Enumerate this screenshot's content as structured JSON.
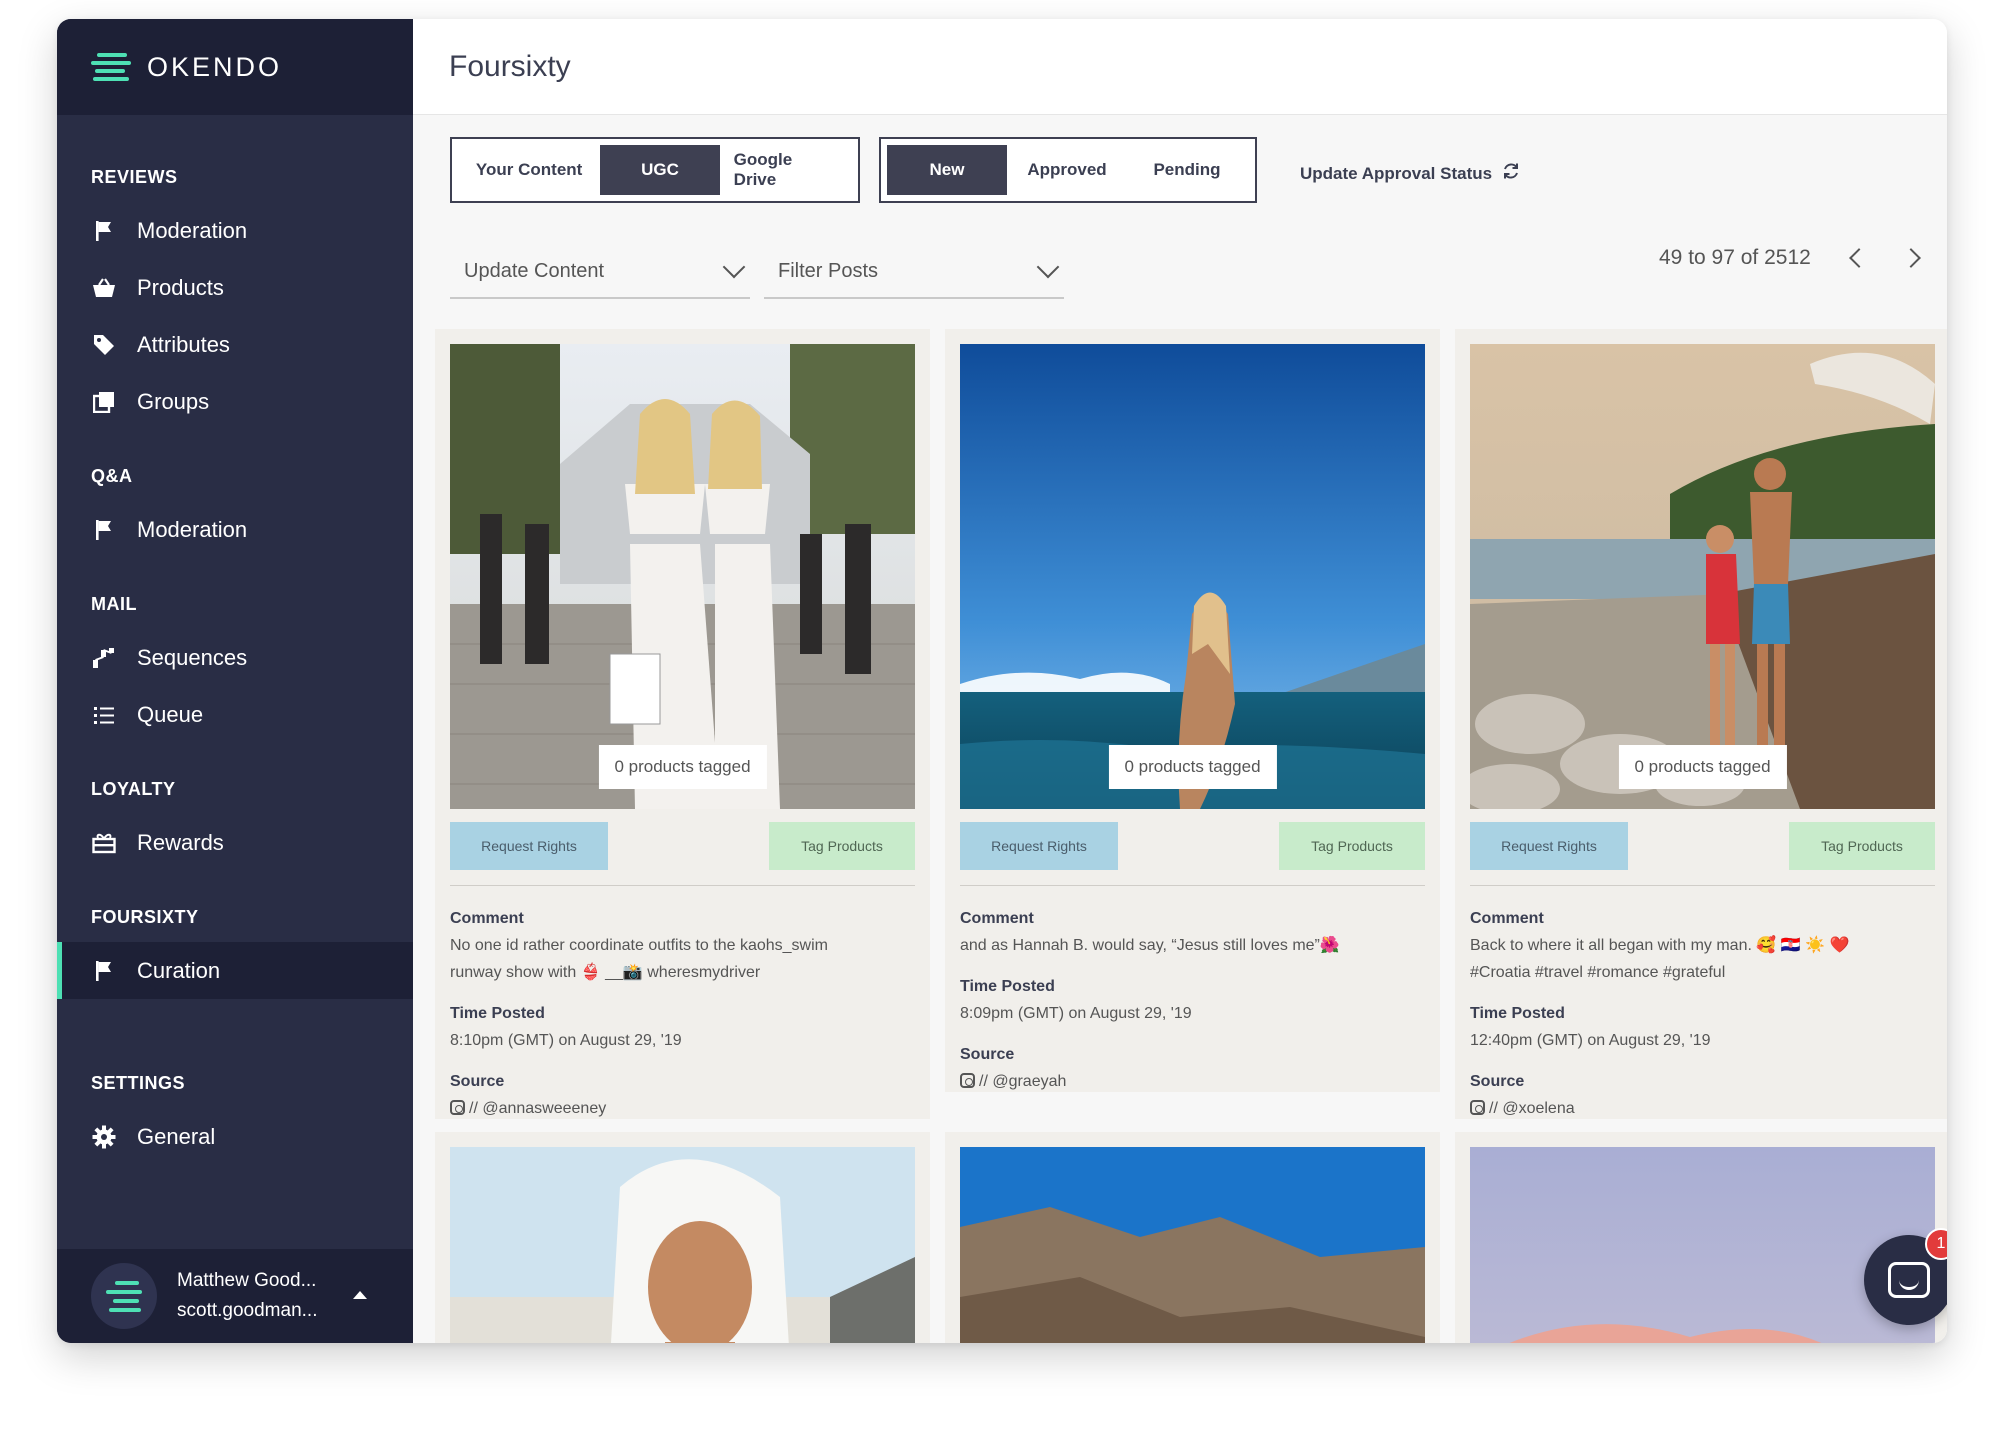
{
  "brand": {
    "name": "OKENDO"
  },
  "sidebar": {
    "sections": [
      {
        "title": "REVIEWS",
        "items": [
          {
            "label": "Moderation",
            "icon": "flag-icon"
          },
          {
            "label": "Products",
            "icon": "basket-icon"
          },
          {
            "label": "Attributes",
            "icon": "tag-icon"
          },
          {
            "label": "Groups",
            "icon": "copy-icon"
          }
        ]
      },
      {
        "title": "Q&A",
        "items": [
          {
            "label": "Moderation",
            "icon": "flag-icon"
          }
        ]
      },
      {
        "title": "MAIL",
        "items": [
          {
            "label": "Sequences",
            "icon": "sequence-icon"
          },
          {
            "label": "Queue",
            "icon": "list-icon"
          }
        ]
      },
      {
        "title": "LOYALTY",
        "items": [
          {
            "label": "Rewards",
            "icon": "gift-icon"
          }
        ]
      },
      {
        "title": "FOURSIXTY",
        "items": [
          {
            "label": "Curation",
            "icon": "flag-icon",
            "active": true
          }
        ]
      },
      {
        "title": "SETTINGS",
        "items": [
          {
            "label": "General",
            "icon": "gear-icon"
          }
        ]
      }
    ],
    "user": {
      "name": "Matthew Good...",
      "email": "scott.goodman..."
    }
  },
  "header": {
    "title": "Foursixty"
  },
  "content_tabs": {
    "options": [
      "Your Content",
      "UGC",
      "Google Drive"
    ],
    "selected": "UGC"
  },
  "status_tabs": {
    "options": [
      "New",
      "Approved",
      "Pending"
    ],
    "selected": "New"
  },
  "update_status": {
    "label": "Update Approval Status",
    "icon": "refresh-icon"
  },
  "update_content": {
    "label": "Update Content"
  },
  "filter_posts": {
    "label": "Filter Posts"
  },
  "pager": {
    "label": "49 to 97 of 2512"
  },
  "cards": [
    {
      "tag_pill": "0 products tagged",
      "request_rights": "Request Rights",
      "tag_products": "Tag Products",
      "comment_label": "Comment",
      "comment_line1": "No one id rather coordinate outfits to the kaohs_swim",
      "comment_line2": "runway show with 👙 __📸 wheresmydriver",
      "time_label": "Time Posted",
      "time": "8:10pm (GMT) on August 29, '19",
      "source_label": "Source",
      "source": "// @annasweeeney"
    },
    {
      "tag_pill": "0 products tagged",
      "request_rights": "Request Rights",
      "tag_products": "Tag Products",
      "comment_label": "Comment",
      "comment_line1": "and as Hannah B. would say, “Jesus still loves me”🌺",
      "comment_line2": "",
      "time_label": "Time Posted",
      "time": "8:09pm (GMT) on August 29, '19",
      "source_label": "Source",
      "source": "// @graeyah"
    },
    {
      "tag_pill": "0 products tagged",
      "request_rights": "Request Rights",
      "tag_products": "Tag Products",
      "comment_label": "Comment",
      "comment_line1": "Back to where it all began with my man. 🥰 🇭🇷 ☀️ ❤️",
      "comment_line2": "#Croatia #travel #romance #grateful",
      "time_label": "Time Posted",
      "time": "12:40pm (GMT) on August 29, '19",
      "source_label": "Source",
      "source": "// @xoelena"
    }
  ],
  "chat": {
    "badge": "1"
  }
}
